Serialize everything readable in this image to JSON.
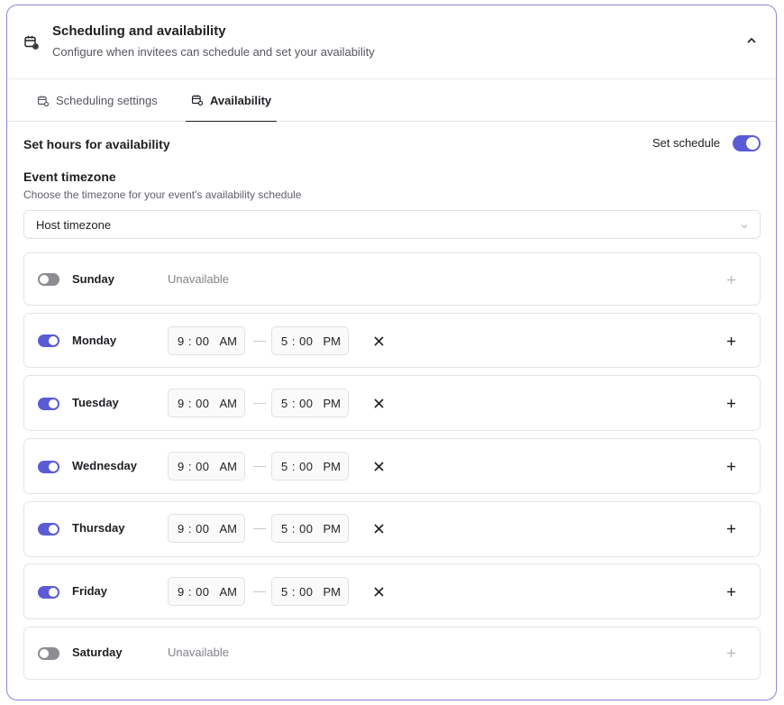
{
  "header": {
    "title": "Scheduling and availability",
    "subtitle": "Configure when invitees can schedule and set your availability",
    "icon": "calendar-settings-icon",
    "collapse_icon": "chevron-up-icon"
  },
  "tabs": [
    {
      "label": "Scheduling settings",
      "active": false
    },
    {
      "label": "Availability",
      "active": true
    }
  ],
  "availability": {
    "title": "Set hours for availability",
    "schedule_label": "Set schedule",
    "schedule_on": true
  },
  "timezone": {
    "title": "Event timezone",
    "description": "Choose the timezone for your event's availability schedule",
    "selected": "Host timezone"
  },
  "days": [
    {
      "name": "Sunday",
      "enabled": false,
      "unavailable_label": "Unavailable"
    },
    {
      "name": "Monday",
      "enabled": true,
      "start": "9 : 00",
      "start_ampm": "AM",
      "end": "5 : 00",
      "end_ampm": "PM"
    },
    {
      "name": "Tuesday",
      "enabled": true,
      "start": "9 : 00",
      "start_ampm": "AM",
      "end": "5 : 00",
      "end_ampm": "PM"
    },
    {
      "name": "Wednesday",
      "enabled": true,
      "start": "9 : 00",
      "start_ampm": "AM",
      "end": "5 : 00",
      "end_ampm": "PM"
    },
    {
      "name": "Thursday",
      "enabled": true,
      "start": "9 : 00",
      "start_ampm": "AM",
      "end": "5 : 00",
      "end_ampm": "PM"
    },
    {
      "name": "Friday",
      "enabled": true,
      "start": "9 : 00",
      "start_ampm": "AM",
      "end": "5 : 00",
      "end_ampm": "PM"
    },
    {
      "name": "Saturday",
      "enabled": false,
      "unavailable_label": "Unavailable"
    }
  ],
  "colors": {
    "accent": "#5b5bd6",
    "toggle_off": "#8c8c93",
    "border": "#8a86d8"
  }
}
